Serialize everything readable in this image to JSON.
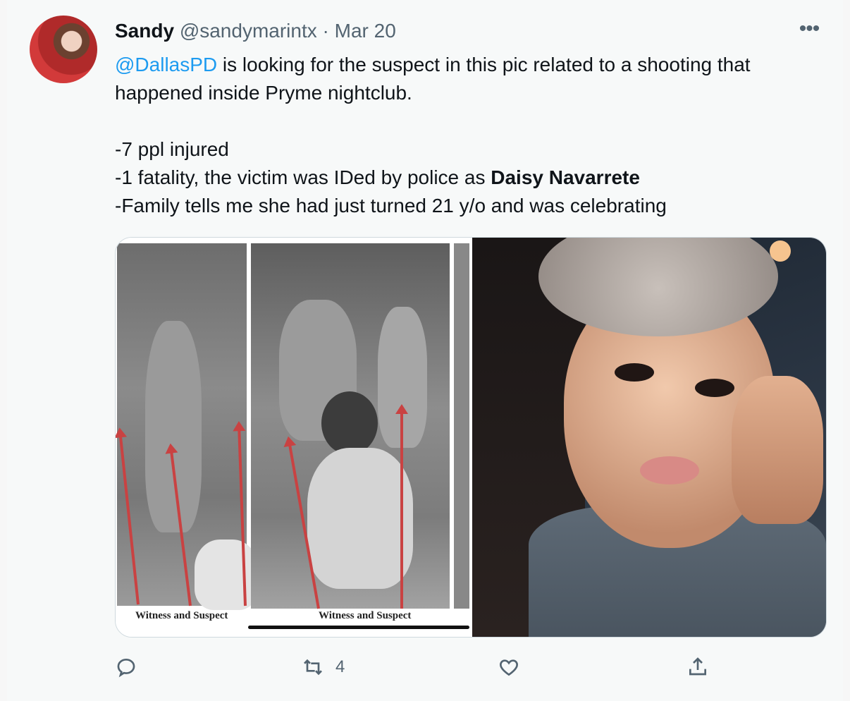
{
  "tweet": {
    "author_name": "Sandy",
    "author_handle": "@sandymarintx",
    "separator": "·",
    "date": "Mar 20",
    "more_label": "•••",
    "mention": "@DallasPD",
    "line1_rest": " is looking for the suspect in this pic related to a shooting that",
    "line2": "happened inside Pryme nightclub.",
    "line3": "-7 ppl injured",
    "line4_prefix": "-1 fatality, the victim was IDed by police as ",
    "line4_bold": "Daisy Navarrete",
    "line5": "-Family tells me she had just turned 21 y/o and was celebrating"
  },
  "media": {
    "caption_left": "Witness and Suspect",
    "caption_right": "Witness and Suspect"
  },
  "actions": {
    "reply_icon": "reply-icon",
    "retweet_icon": "retweet-icon",
    "retweet_count": "4",
    "like_icon": "heart-icon",
    "share_icon": "share-icon"
  },
  "colors": {
    "link": "#1d9bf0",
    "secondary_text": "#536471",
    "arrow_red": "#c94242"
  }
}
